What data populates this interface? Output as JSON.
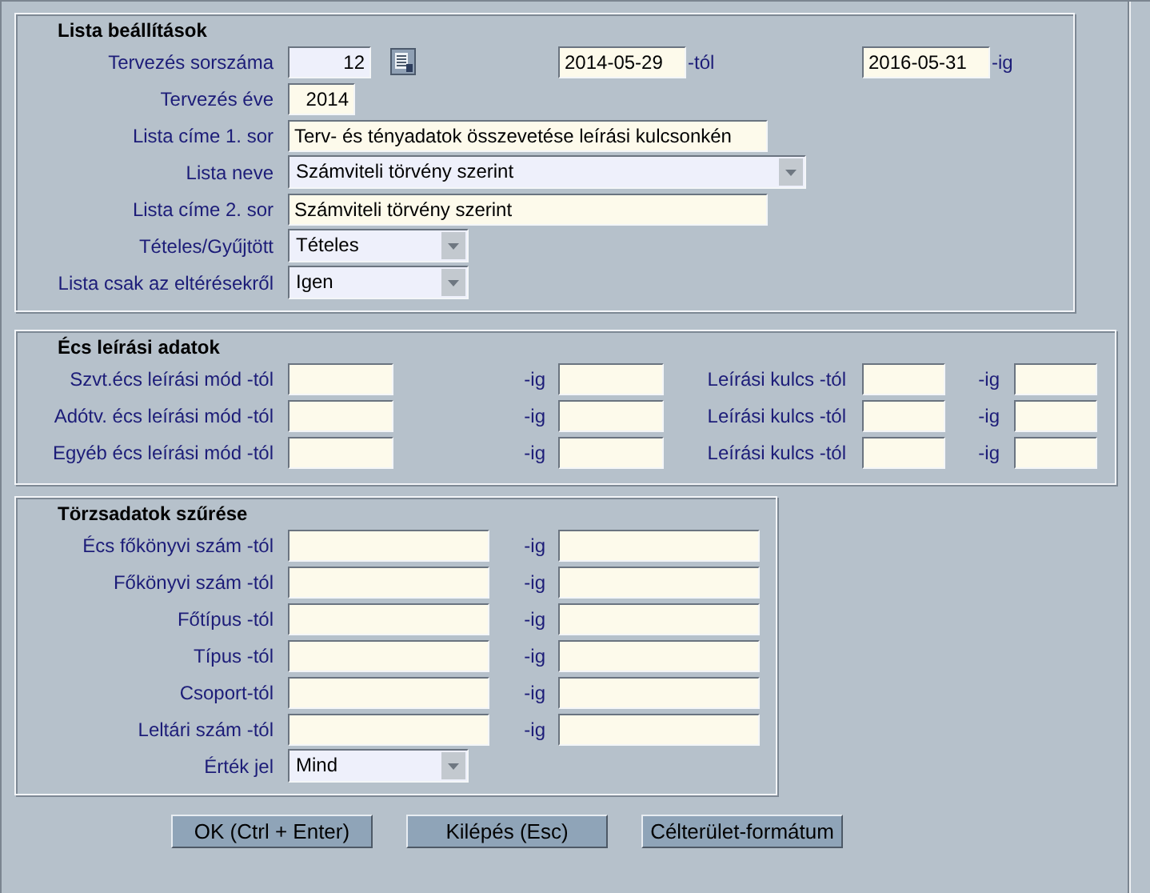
{
  "sections": [
    {
      "title": "Lista beállítások",
      "rows": [
        {
          "label": "Tervezés sorszáma",
          "items": [
            {
              "kind": "readonly",
              "value": "12"
            },
            {
              "kind": "lookup"
            },
            {
              "kind": "input",
              "value": "2014-05-29"
            },
            {
              "kind": "text",
              "text": "-tól"
            },
            {
              "kind": "input",
              "value": "2016-05-31"
            },
            {
              "kind": "text",
              "text": "-ig"
            }
          ]
        },
        {
          "label": "Tervezés éve",
          "items": [
            {
              "kind": "input",
              "value": "2014"
            }
          ]
        },
        {
          "label": "Lista címe 1. sor",
          "items": [
            {
              "kind": "input",
              "value": "Terv- és tényadatok összevetése leírási kulcsonkén"
            }
          ]
        },
        {
          "label": "Lista neve",
          "items": [
            {
              "kind": "select",
              "value": "Számviteli törvény szerint"
            }
          ]
        },
        {
          "label": "Lista címe 2. sor",
          "items": [
            {
              "kind": "input",
              "value": "Számviteli törvény szerint"
            }
          ]
        },
        {
          "label": "Tételes/Gyűjtött",
          "items": [
            {
              "kind": "select",
              "value": "Tételes"
            }
          ]
        },
        {
          "label": "Lista csak az eltérésekről",
          "items": [
            {
              "kind": "select",
              "value": "Igen"
            }
          ]
        }
      ]
    },
    {
      "title": "Écs leírási adatok",
      "rows": [
        {
          "label": "Szvt.écs leírási mód -tól",
          "items": [
            {
              "kind": "input"
            },
            {
              "kind": "text",
              "text": "-ig"
            },
            {
              "kind": "input"
            },
            {
              "kind": "text",
              "text": "Leírási kulcs -tól"
            },
            {
              "kind": "input"
            },
            {
              "kind": "text",
              "text": "-ig"
            },
            {
              "kind": "input"
            }
          ]
        },
        {
          "label": "Adótv. écs leírási mód -tól",
          "items": [
            {
              "kind": "input"
            },
            {
              "kind": "text",
              "text": "-ig"
            },
            {
              "kind": "input"
            },
            {
              "kind": "text",
              "text": "Leírási kulcs -tól"
            },
            {
              "kind": "input"
            },
            {
              "kind": "text",
              "text": "-ig"
            },
            {
              "kind": "input"
            }
          ]
        },
        {
          "label": "Egyéb écs leírási mód -tól",
          "items": [
            {
              "kind": "input"
            },
            {
              "kind": "text",
              "text": "-ig"
            },
            {
              "kind": "input"
            },
            {
              "kind": "text",
              "text": "Leírási kulcs -tól"
            },
            {
              "kind": "input"
            },
            {
              "kind": "text",
              "text": "-ig"
            },
            {
              "kind": "input"
            }
          ]
        }
      ]
    },
    {
      "title": "Törzsadatok szűrése",
      "rows": [
        {
          "label": "Écs főkönyvi szám -tól",
          "items": [
            {
              "kind": "input"
            },
            {
              "kind": "text",
              "text": "-ig"
            },
            {
              "kind": "input"
            }
          ]
        },
        {
          "label": "Főkönyvi szám -tól",
          "items": [
            {
              "kind": "input"
            },
            {
              "kind": "text",
              "text": "-ig"
            },
            {
              "kind": "input"
            }
          ]
        },
        {
          "label": "Főtípus -tól",
          "items": [
            {
              "kind": "input"
            },
            {
              "kind": "text",
              "text": "-ig"
            },
            {
              "kind": "input"
            }
          ]
        },
        {
          "label": "Típus -tól",
          "items": [
            {
              "kind": "input"
            },
            {
              "kind": "text",
              "text": "-ig"
            },
            {
              "kind": "input"
            }
          ]
        },
        {
          "label": "Csoport-tól",
          "items": [
            {
              "kind": "input"
            },
            {
              "kind": "text",
              "text": "-ig"
            },
            {
              "kind": "input"
            }
          ]
        },
        {
          "label": "Leltári szám -tól",
          "items": [
            {
              "kind": "input"
            },
            {
              "kind": "text",
              "text": "-ig"
            },
            {
              "kind": "input"
            }
          ]
        },
        {
          "label": "Érték jel",
          "items": [
            {
              "kind": "select",
              "value": "Mind"
            }
          ]
        }
      ]
    }
  ],
  "buttons": [
    "OK (Ctrl + Enter)",
    "Kilépés (Esc)",
    "Célterület-formátum"
  ]
}
